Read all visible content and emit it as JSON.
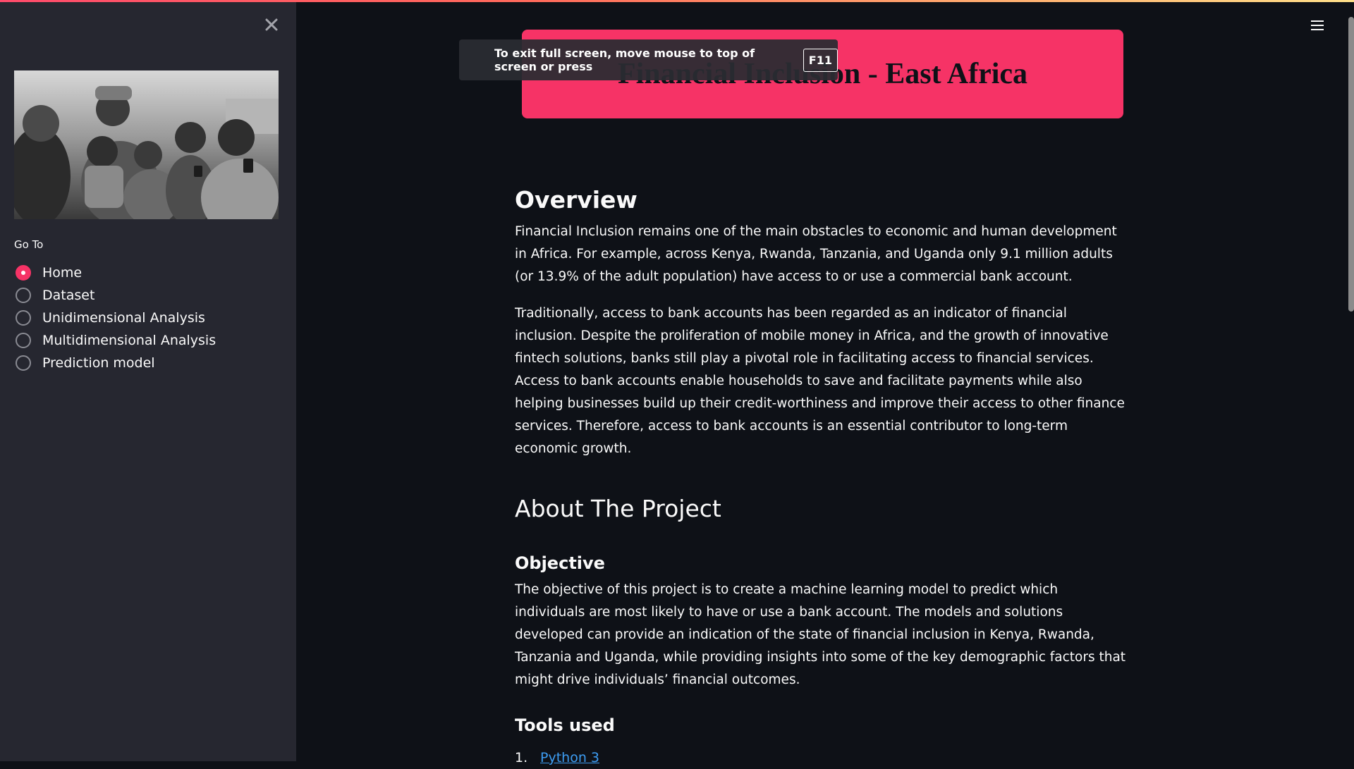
{
  "colors": {
    "accent": "#f63366",
    "sidebar_bg": "#262730",
    "main_bg": "#0e1117",
    "text": "#fafafa",
    "link": "#3d9df3"
  },
  "sidebar": {
    "close_icon": "close-icon",
    "nav_label": "Go To",
    "nav_items": [
      {
        "label": "Home",
        "selected": true
      },
      {
        "label": "Dataset",
        "selected": false
      },
      {
        "label": "Unidimensional Analysis",
        "selected": false
      },
      {
        "label": "Multidimensional Analysis",
        "selected": false
      },
      {
        "label": "Prediction model",
        "selected": false
      }
    ]
  },
  "fullscreen_notice": {
    "text": "To exit full screen, move mouse to top of screen or press",
    "key": "F11"
  },
  "banner": {
    "title": "Financial Inclusion - East Africa"
  },
  "main": {
    "overview_heading": "Overview",
    "overview_p1": "Financial Inclusion remains one of the main obstacles to economic and human development in Africa. For example, across Kenya, Rwanda, Tanzania, and Uganda only 9.1 million adults (or 13.9% of the adult population) have access to or use a commercial bank account.",
    "overview_p2": "Traditionally, access to bank accounts has been regarded as an indicator of financial inclusion. Despite the proliferation of mobile money in Africa, and the growth of innovative fintech solutions, banks still play a pivotal role in facilitating access to financial services. Access to bank accounts enable households to save and facilitate payments while also helping businesses build up their credit-worthiness and improve their access to other finance services. Therefore, access to bank accounts is an essential contributor to long-term economic growth.",
    "about_heading": "About The Project",
    "objective_heading": "Objective",
    "objective_text": "The objective of this project is to create a machine learning model to predict which individuals are most likely to have or use a bank account. The models and solutions developed can provide an indication of the state of financial inclusion in Kenya, Rwanda, Tanzania and Uganda, while providing insights into some of the key demographic factors that might drive individuals’ financial outcomes.",
    "tools_heading": "Tools used",
    "tools": [
      {
        "number": "1.",
        "label": "Python 3"
      }
    ]
  }
}
